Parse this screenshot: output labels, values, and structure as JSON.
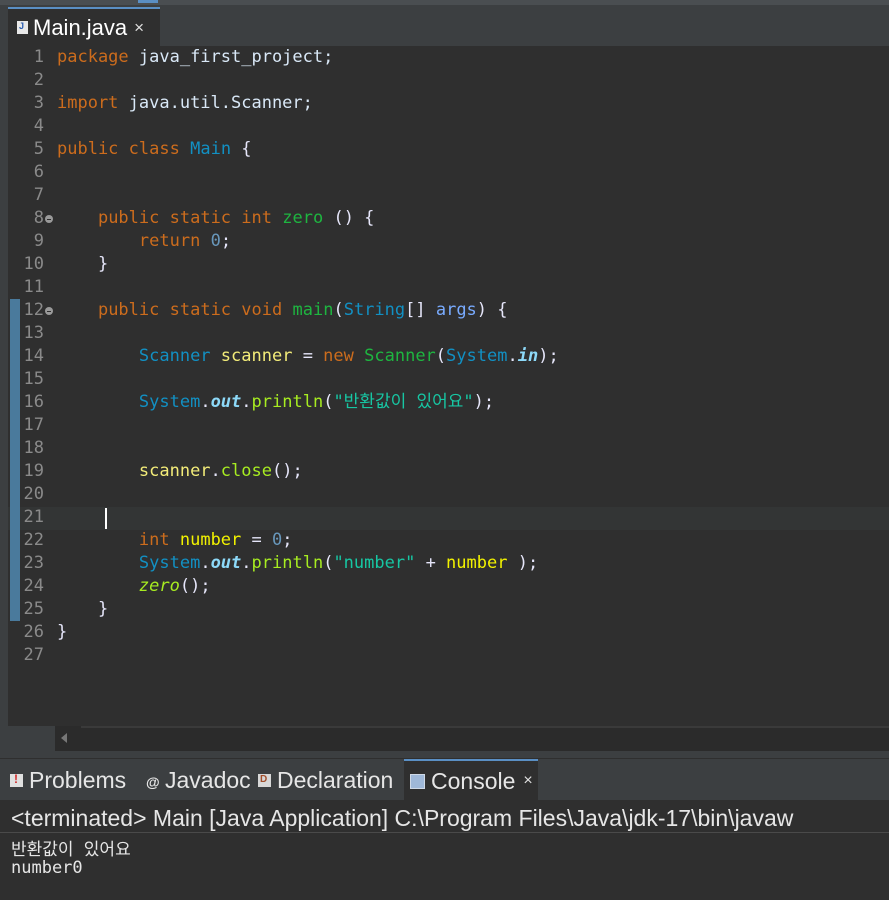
{
  "editor": {
    "tab": {
      "label": "Main.java",
      "close": "×",
      "icon": "java-file-icon"
    },
    "line_numbers": [
      "1",
      "2",
      "3",
      "4",
      "5",
      "6",
      "7",
      "8",
      "9",
      "10",
      "11",
      "12",
      "13",
      "14",
      "15",
      "16",
      "17",
      "18",
      "19",
      "20",
      "21",
      "22",
      "23",
      "24",
      "25",
      "26",
      "27"
    ],
    "folded_lines": [
      "8",
      "12"
    ],
    "current_line": "21",
    "lines": [
      [
        {
          "t": "package",
          "c": "kw"
        },
        {
          "t": " java_first_project;",
          "c": "pl"
        }
      ],
      [],
      [
        {
          "t": "import",
          "c": "kw"
        },
        {
          "t": " java.util.Scanner;",
          "c": "pl"
        }
      ],
      [],
      [
        {
          "t": "public",
          "c": "kw"
        },
        {
          "t": " ",
          "c": "pl"
        },
        {
          "t": "class",
          "c": "kw"
        },
        {
          "t": " ",
          "c": "pl"
        },
        {
          "t": "Main",
          "c": "ty"
        },
        {
          "t": " {",
          "c": "op"
        }
      ],
      [],
      [],
      [
        {
          "t": "    ",
          "c": "pl"
        },
        {
          "t": "public",
          "c": "kw"
        },
        {
          "t": " ",
          "c": "pl"
        },
        {
          "t": "static",
          "c": "kw"
        },
        {
          "t": " ",
          "c": "pl"
        },
        {
          "t": "int",
          "c": "kw"
        },
        {
          "t": " ",
          "c": "pl"
        },
        {
          "t": "zero",
          "c": "cn"
        },
        {
          "t": " () {",
          "c": "op"
        }
      ],
      [
        {
          "t": "        ",
          "c": "pl"
        },
        {
          "t": "return",
          "c": "kw"
        },
        {
          "t": " ",
          "c": "pl"
        },
        {
          "t": "0",
          "c": "nm"
        },
        {
          "t": ";",
          "c": "op"
        }
      ],
      [
        {
          "t": "    }",
          "c": "op"
        }
      ],
      [],
      [
        {
          "t": "    ",
          "c": "pl"
        },
        {
          "t": "public",
          "c": "kw"
        },
        {
          "t": " ",
          "c": "pl"
        },
        {
          "t": "static",
          "c": "kw"
        },
        {
          "t": " ",
          "c": "pl"
        },
        {
          "t": "void",
          "c": "kw"
        },
        {
          "t": " ",
          "c": "pl"
        },
        {
          "t": "main",
          "c": "cn"
        },
        {
          "t": "(",
          "c": "op"
        },
        {
          "t": "String",
          "c": "ty"
        },
        {
          "t": "[] ",
          "c": "op"
        },
        {
          "t": "args",
          "c": "pm"
        },
        {
          "t": ") {",
          "c": "op"
        }
      ],
      [],
      [
        {
          "t": "        ",
          "c": "pl"
        },
        {
          "t": "Scanner",
          "c": "ty"
        },
        {
          "t": " ",
          "c": "pl"
        },
        {
          "t": "scanner",
          "c": "lv"
        },
        {
          "t": " = ",
          "c": "op"
        },
        {
          "t": "new",
          "c": "kw"
        },
        {
          "t": " ",
          "c": "pl"
        },
        {
          "t": "Scanner",
          "c": "cn"
        },
        {
          "t": "(",
          "c": "op"
        },
        {
          "t": "System",
          "c": "ty"
        },
        {
          "t": ".",
          "c": "op"
        },
        {
          "t": "in",
          "c": "fi"
        },
        {
          "t": ");",
          "c": "op"
        }
      ],
      [],
      [
        {
          "t": "        ",
          "c": "pl"
        },
        {
          "t": "System",
          "c": "ty"
        },
        {
          "t": ".",
          "c": "op"
        },
        {
          "t": "out",
          "c": "fi"
        },
        {
          "t": ".",
          "c": "op"
        },
        {
          "t": "println",
          "c": "mt"
        },
        {
          "t": "(",
          "c": "op"
        },
        {
          "t": "\"반환값이 있어요\"",
          "c": "st"
        },
        {
          "t": ");",
          "c": "op"
        }
      ],
      [],
      [],
      [
        {
          "t": "        ",
          "c": "pl"
        },
        {
          "t": "scanner",
          "c": "lv"
        },
        {
          "t": ".",
          "c": "op"
        },
        {
          "t": "close",
          "c": "mt"
        },
        {
          "t": "();",
          "c": "op"
        }
      ],
      [],
      [],
      [
        {
          "t": "        ",
          "c": "pl"
        },
        {
          "t": "int",
          "c": "kw"
        },
        {
          "t": " ",
          "c": "pl"
        },
        {
          "t": "number",
          "c": "vr"
        },
        {
          "t": " = ",
          "c": "op"
        },
        {
          "t": "0",
          "c": "nm"
        },
        {
          "t": ";",
          "c": "op"
        }
      ],
      [
        {
          "t": "        ",
          "c": "pl"
        },
        {
          "t": "System",
          "c": "ty"
        },
        {
          "t": ".",
          "c": "op"
        },
        {
          "t": "out",
          "c": "fi"
        },
        {
          "t": ".",
          "c": "op"
        },
        {
          "t": "println",
          "c": "mt"
        },
        {
          "t": "(",
          "c": "op"
        },
        {
          "t": "\"number\"",
          "c": "st"
        },
        {
          "t": " + ",
          "c": "op"
        },
        {
          "t": "number",
          "c": "vr"
        },
        {
          "t": " );",
          "c": "op"
        }
      ],
      [
        {
          "t": "        ",
          "c": "pl"
        },
        {
          "t": "zero",
          "c": "sm"
        },
        {
          "t": "();",
          "c": "op"
        }
      ],
      [
        {
          "t": "    }",
          "c": "op"
        }
      ],
      [
        {
          "t": "}",
          "c": "op"
        }
      ],
      []
    ]
  },
  "panel": {
    "tabs": [
      {
        "id": "problems",
        "label": "Problems",
        "icon": "problems-icon"
      },
      {
        "id": "javadoc",
        "label": "Javadoc",
        "icon": "javadoc-icon"
      },
      {
        "id": "declaration",
        "label": "Declaration",
        "icon": "declaration-icon"
      },
      {
        "id": "console",
        "label": "Console",
        "icon": "console-icon",
        "close": "×",
        "active": true
      }
    ],
    "javadoc_glyph": "@",
    "console": {
      "status": "<terminated> Main [Java Application] C:\\Program Files\\Java\\jdk-17\\bin\\javaw",
      "output": [
        "반환값이 있어요",
        "number0"
      ]
    }
  },
  "colors": {
    "keyword": "#cc6c1d",
    "type": "#1290c3",
    "string": "#17c6a3",
    "number": "#6897bb",
    "method": "#a7ec21",
    "editor_bg": "#2f2f2f",
    "accent": "#5a8fc4"
  }
}
